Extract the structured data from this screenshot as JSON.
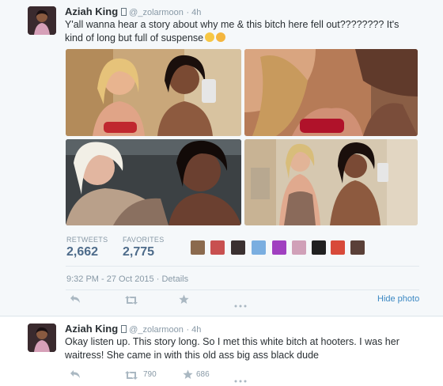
{
  "tweet1": {
    "author_name": "Aziah King",
    "author_handle": "@_zolarmoon",
    "time_ago": "· 4h",
    "text": "Y'all wanna hear a story about why me & this bitch here fell out???????? It's kind of long but full of suspense",
    "stats": {
      "retweets_label": "RETWEETS",
      "retweets_value": "2,662",
      "favorites_label": "FAVORITES",
      "favorites_value": "2,775"
    },
    "timestamp": "9:32 PM - 27 Oct 2015",
    "details_label": "Details",
    "hide_photo_label": "Hide photo",
    "icons": {
      "reply": "reply-icon",
      "retweet": "retweet-icon",
      "favorite": "star-icon",
      "more": "more-icon"
    }
  },
  "tweet2": {
    "author_name": "Aziah King",
    "author_handle": "@_zolarmoon",
    "time_ago": "· 4h",
    "text": "Okay listen up. This story long. So I met this white bitch at hooters. I was her waitress! She came in with this old ass big ass black dude",
    "retweet_count": "790",
    "favorite_count": "686"
  },
  "colors": {
    "link": "#3b88c3",
    "stat_value": "#4d6b8a",
    "muted": "#8899a6",
    "background": "#f5f8fa"
  }
}
